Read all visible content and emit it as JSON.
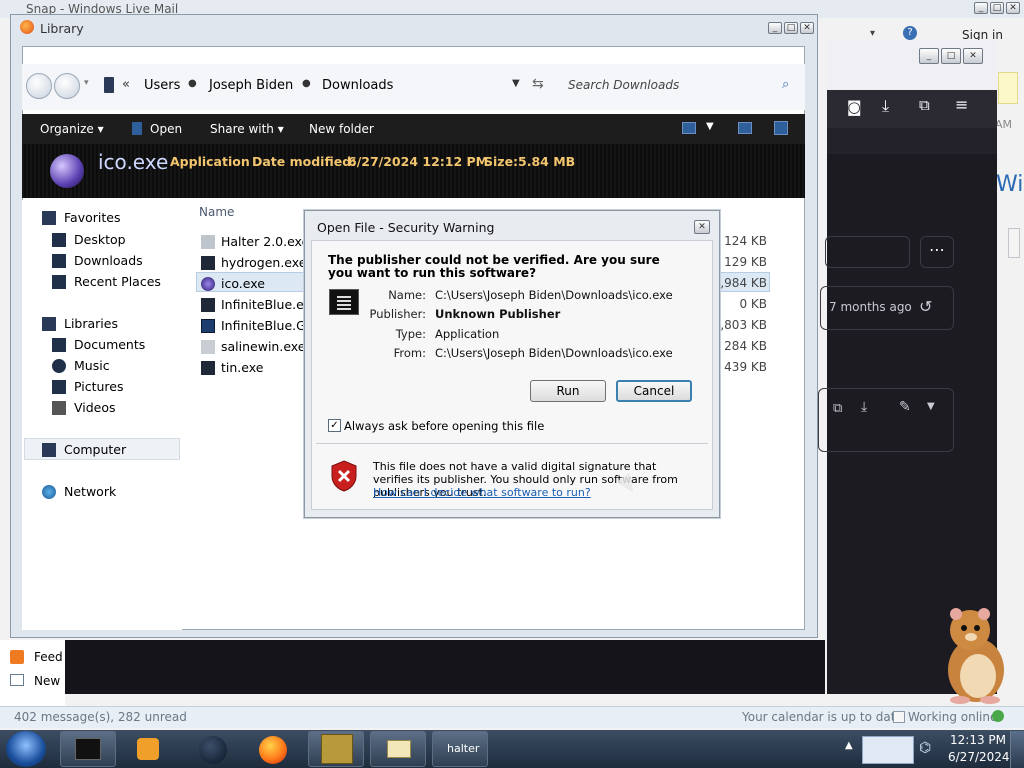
{
  "mail": {
    "title": "Snap - Windows Live Mail",
    "sign_in": "Sign in",
    "side_time": "AM",
    "side_wi": "Wi",
    "feed_label": "Feed",
    "new_label": "New",
    "status_left": "402 message(s), 282 unread",
    "status_calendar": "Your calendar is up to date",
    "status_online": "Working online"
  },
  "firefox": {
    "time_ago": "7 months ago"
  },
  "library": {
    "title": "Library",
    "breadcrumb": [
      "Users",
      "Joseph Biden",
      "Downloads"
    ],
    "search_placeholder": "Search Downloads",
    "toolbar": {
      "organize": "Organize",
      "open": "Open",
      "share_with": "Share with",
      "new_folder": "New folder"
    },
    "details": {
      "filename": "ico.exe",
      "type": "Application",
      "date_label": "Date modified:",
      "date_value": "6/27/2024 12:12 PM",
      "size_label": "Size:",
      "size_value": "5.84 MB"
    },
    "nav": {
      "favorites": "Favorites",
      "desktop": "Desktop",
      "downloads": "Downloads",
      "recent": "Recent Places",
      "libraries": "Libraries",
      "documents": "Documents",
      "music": "Music",
      "pictures": "Pictures",
      "videos": "Videos",
      "computer": "Computer",
      "network": "Network"
    },
    "column_name": "Name",
    "files": [
      {
        "name": "Halter 2.0.exe",
        "size": "124 KB"
      },
      {
        "name": "hydrogen.exe",
        "size": "129 KB"
      },
      {
        "name": "ico.exe",
        "size": "5,984 KB"
      },
      {
        "name": "InfiniteBlue.exe",
        "size": "0 KB"
      },
      {
        "name": "InfiniteBlue.G2K",
        "size": "1,803 KB"
      },
      {
        "name": "salinewin.exe",
        "size": "284 KB"
      },
      {
        "name": "tin.exe",
        "size": "439 KB"
      }
    ]
  },
  "dialog": {
    "title": "Open File - Security Warning",
    "question": "The publisher could not be verified.  Are you sure you want to run this software?",
    "name_label": "Name:",
    "name_value": "C:\\Users\\Joseph Biden\\Downloads\\ico.exe",
    "publisher_label": "Publisher:",
    "publisher_value": "Unknown Publisher",
    "type_label": "Type:",
    "type_value": "Application",
    "from_label": "From:",
    "from_value": "C:\\Users\\Joseph Biden\\Downloads\\ico.exe",
    "run": "Run",
    "cancel": "Cancel",
    "always_ask": "Always ask before opening this file",
    "always_ask_checked": true,
    "warning_text": "This file does not have a valid digital signature that verifies its publisher.  You should only run software from publishers you trust.",
    "help_link": "How can I decide what software to run?"
  },
  "taskbar": {
    "halter_label": "halter",
    "clock_time": "12:13 PM",
    "clock_date": "6/27/2024"
  }
}
